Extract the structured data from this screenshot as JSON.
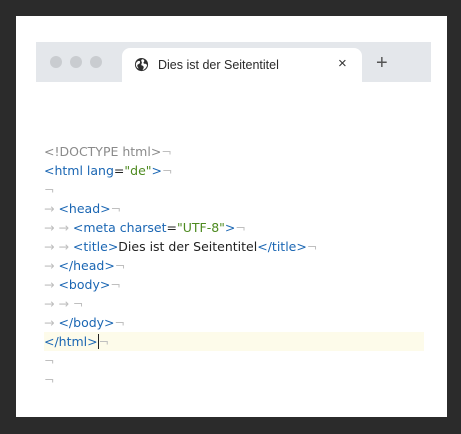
{
  "tab": {
    "title": "Dies ist der Seitentitel",
    "close_glyph": "×",
    "new_tab_glyph": "+"
  },
  "icons": {
    "globe": "globe-icon"
  },
  "colors": {
    "tag": "#1a66b3",
    "string": "#4d8a1f",
    "invisible": "#bfbfbf",
    "doctype": "#8a8a8a",
    "current_line": "#fdfbea"
  },
  "code": {
    "l1": {
      "text": "<!DOCTYPE html>",
      "eol": "¬"
    },
    "l2": {
      "open": "<html ",
      "attr": "lang",
      "eq": "=",
      "val": "\"de\"",
      "close": ">",
      "eol": "¬"
    },
    "l3": {
      "eol": "¬"
    },
    "l4": {
      "tab": "→ ",
      "tag": "<head>",
      "eol": "¬"
    },
    "l5": {
      "tab": "→ → ",
      "open": "<meta ",
      "attr": "charset",
      "eq": "=",
      "val": "\"UTF-8\"",
      "close": ">",
      "eol": "¬"
    },
    "l6": {
      "tab": "→ → ",
      "open": "<title>",
      "text": "Dies ist der Seitentitel",
      "close": "</title>",
      "eol": "¬"
    },
    "l7": {
      "tab": "→ ",
      "tag": "</head>",
      "eol": "¬"
    },
    "l8": {
      "tab": "→ ",
      "tag": "<body>",
      "eol": "¬"
    },
    "l9": {
      "tab": "→ → ",
      "eol": "¬"
    },
    "l10": {
      "tab": "→ ",
      "tag": "</body>",
      "eol": "¬"
    },
    "l11": {
      "tag": "</html>",
      "eol": "¬"
    },
    "l12": {
      "eol": "¬"
    },
    "l13": {
      "eol": "¬"
    }
  }
}
